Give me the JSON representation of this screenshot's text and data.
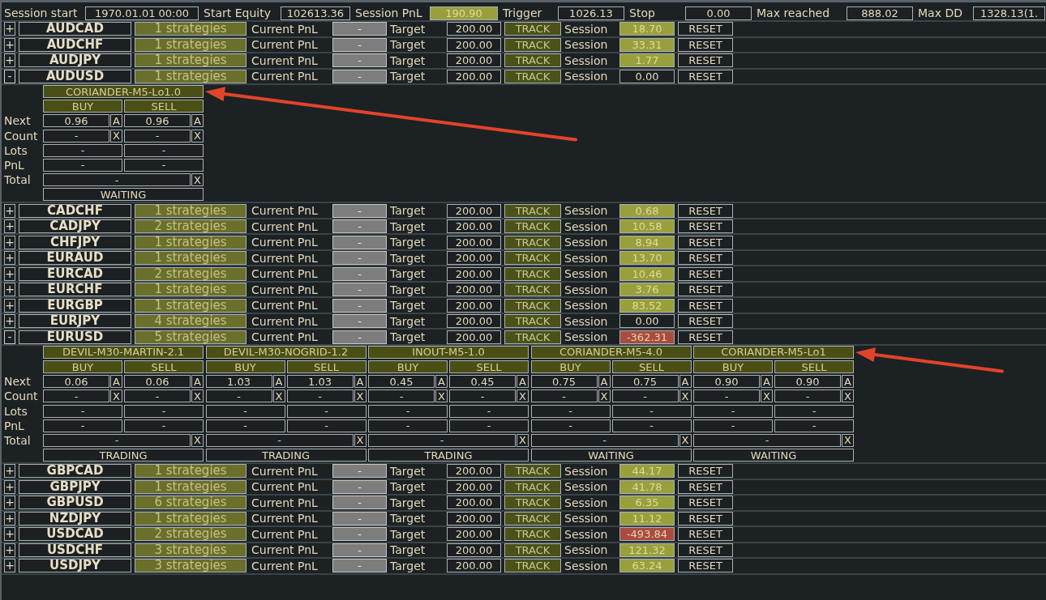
{
  "top_bar": {
    "fields": [
      {
        "label": "Session start",
        "value": "1970.01.01 00:00",
        "color": "#1c2022"
      },
      {
        "label": "Start Equity",
        "value": "102613.36",
        "color": "#1c2022"
      },
      {
        "label": "Session PnL",
        "value": "190.90",
        "color": "#98a03c"
      },
      {
        "label": "Trigger",
        "value": "1026.13",
        "color": "#1c2022"
      },
      {
        "label": "Stop",
        "value": "0.00",
        "color": "#1c2022"
      },
      {
        "label": "Max reached",
        "value": "888.02",
        "color": "#1c2022"
      },
      {
        "label": "Max DD",
        "value": "1328.13(1.",
        "color": "#1c2022"
      }
    ]
  },
  "rows": [
    {
      "toggle": "+",
      "expanded": false,
      "symbol": "AUDCAD",
      "strategies": "1 strategies",
      "pnl_label": "Current PnL",
      "current_pnl": "-",
      "target_label": "Target",
      "target": "200.00",
      "track": "TRACK",
      "session_label": "Session",
      "session": {
        "value": "18.70",
        "color": "#98a03c"
      },
      "reset": "RESET"
    },
    {
      "toggle": "+",
      "expanded": false,
      "symbol": "AUDCHF",
      "strategies": "1 strategies",
      "pnl_label": "Current PnL",
      "current_pnl": "-",
      "target_label": "Target",
      "target": "200.00",
      "track": "TRACK",
      "session_label": "Session",
      "session": {
        "value": "33.31",
        "color": "#98a03c"
      },
      "reset": "RESET"
    },
    {
      "toggle": "+",
      "expanded": false,
      "symbol": "AUDJPY",
      "strategies": "1 strategies",
      "pnl_label": "Current PnL",
      "current_pnl": "-",
      "target_label": "Target",
      "target": "200.00",
      "track": "TRACK",
      "session_label": "Session",
      "session": {
        "value": "1.77",
        "color": "#98a03c"
      },
      "reset": "RESET"
    },
    {
      "toggle": "-",
      "expanded": true,
      "symbol": "AUDUSD",
      "strategies": "1 strategies",
      "pnl_label": "Current PnL",
      "current_pnl": "-",
      "target_label": "Target",
      "target": "200.00",
      "track": "TRACK",
      "session_label": "Session",
      "session": {
        "value": "0.00",
        "color": "#1c2022"
      },
      "reset": "RESET",
      "panel": {
        "row_labels": [
          "Next",
          "Count",
          "Lots",
          "PnL",
          "Total"
        ],
        "strategies": [
          {
            "name": "CORIANDER-M5-Lo1.0",
            "marked": true,
            "sides": [
              {
                "label": "BUY",
                "next": "0.96",
                "next_action": "A",
                "count": "-",
                "count_action": "X",
                "lots": "-",
                "pnl": "-"
              },
              {
                "label": "SELL",
                "next": "0.96",
                "next_action": "A",
                "count": "-",
                "count_action": "X",
                "lots": "-",
                "pnl": "-"
              }
            ],
            "total": "-",
            "total_action": "X",
            "status": "WAITING"
          }
        ]
      }
    },
    {
      "toggle": "+",
      "expanded": false,
      "symbol": "CADCHF",
      "strategies": "1 strategies",
      "pnl_label": "Current PnL",
      "current_pnl": "-",
      "target_label": "Target",
      "target": "200.00",
      "track": "TRACK",
      "session_label": "Session",
      "session": {
        "value": "0.68",
        "color": "#98a03c"
      },
      "reset": "RESET"
    },
    {
      "toggle": "+",
      "expanded": false,
      "symbol": "CADJPY",
      "strategies": "2 strategies",
      "pnl_label": "Current PnL",
      "current_pnl": "-",
      "target_label": "Target",
      "target": "200.00",
      "track": "TRACK",
      "session_label": "Session",
      "session": {
        "value": "10.58",
        "color": "#98a03c"
      },
      "reset": "RESET"
    },
    {
      "toggle": "+",
      "expanded": false,
      "symbol": "CHFJPY",
      "strategies": "1 strategies",
      "pnl_label": "Current PnL",
      "current_pnl": "-",
      "target_label": "Target",
      "target": "200.00",
      "track": "TRACK",
      "session_label": "Session",
      "session": {
        "value": "8.94",
        "color": "#98a03c"
      },
      "reset": "RESET"
    },
    {
      "toggle": "+",
      "expanded": false,
      "symbol": "EURAUD",
      "strategies": "1 strategies",
      "pnl_label": "Current PnL",
      "current_pnl": "-",
      "target_label": "Target",
      "target": "200.00",
      "track": "TRACK",
      "session_label": "Session",
      "session": {
        "value": "13.70",
        "color": "#98a03c"
      },
      "reset": "RESET"
    },
    {
      "toggle": "+",
      "expanded": false,
      "symbol": "EURCAD",
      "strategies": "2 strategies",
      "pnl_label": "Current PnL",
      "current_pnl": "-",
      "target_label": "Target",
      "target": "200.00",
      "track": "TRACK",
      "session_label": "Session",
      "session": {
        "value": "10.46",
        "color": "#98a03c"
      },
      "reset": "RESET"
    },
    {
      "toggle": "+",
      "expanded": false,
      "symbol": "EURCHF",
      "strategies": "1 strategies",
      "pnl_label": "Current PnL",
      "current_pnl": "-",
      "target_label": "Target",
      "target": "200.00",
      "track": "TRACK",
      "session_label": "Session",
      "session": {
        "value": "3.76",
        "color": "#98a03c"
      },
      "reset": "RESET"
    },
    {
      "toggle": "+",
      "expanded": false,
      "symbol": "EURGBP",
      "strategies": "1 strategies",
      "pnl_label": "Current PnL",
      "current_pnl": "-",
      "target_label": "Target",
      "target": "200.00",
      "track": "TRACK",
      "session_label": "Session",
      "session": {
        "value": "83.52",
        "color": "#98a03c"
      },
      "reset": "RESET"
    },
    {
      "toggle": "+",
      "expanded": false,
      "symbol": "EURJPY",
      "strategies": "4 strategies",
      "pnl_label": "Current PnL",
      "current_pnl": "-",
      "target_label": "Target",
      "target": "200.00",
      "track": "TRACK",
      "session_label": "Session",
      "session": {
        "value": "0.00",
        "color": "#1c2022"
      },
      "reset": "RESET"
    },
    {
      "toggle": "-",
      "expanded": true,
      "symbol": "EURUSD",
      "strategies": "5 strategies",
      "pnl_label": "Current PnL",
      "current_pnl": "-",
      "target_label": "Target",
      "target": "200.00",
      "track": "TRACK",
      "session_label": "Session",
      "session": {
        "value": "-362.31",
        "color": "#a84c42"
      },
      "reset": "RESET",
      "panel": {
        "row_labels": [
          "Next",
          "Count",
          "Lots",
          "PnL",
          "Total"
        ],
        "strategies": [
          {
            "name": "DEVIL-M30-MARTIN-2.1",
            "marked": false,
            "sides": [
              {
                "label": "BUY",
                "next": "0.06",
                "next_action": "A",
                "count": "-",
                "count_action": "X",
                "lots": "-",
                "pnl": "-"
              },
              {
                "label": "SELL",
                "next": "0.06",
                "next_action": "A",
                "count": "-",
                "count_action": "X",
                "lots": "-",
                "pnl": "-"
              }
            ],
            "total": "-",
            "total_action": "X",
            "status": "TRADING"
          },
          {
            "name": "DEVIL-M30-NOGRID-1.2",
            "marked": false,
            "sides": [
              {
                "label": "BUY",
                "next": "1.03",
                "next_action": "A",
                "count": "-",
                "count_action": "X",
                "lots": "-",
                "pnl": "-"
              },
              {
                "label": "SELL",
                "next": "1.03",
                "next_action": "A",
                "count": "-",
                "count_action": "X",
                "lots": "-",
                "pnl": "-"
              }
            ],
            "total": "-",
            "total_action": "X",
            "status": "TRADING"
          },
          {
            "name": "INOUT-M5-1.0",
            "marked": false,
            "sides": [
              {
                "label": "BUY",
                "next": "0.45",
                "next_action": "A",
                "count": "-",
                "count_action": "X",
                "lots": "-",
                "pnl": "-"
              },
              {
                "label": "SELL",
                "next": "0.45",
                "next_action": "A",
                "count": "-",
                "count_action": "X",
                "lots": "-",
                "pnl": "-"
              }
            ],
            "total": "-",
            "total_action": "X",
            "status": "TRADING"
          },
          {
            "name": "CORIANDER-M5-4.0",
            "marked": false,
            "sides": [
              {
                "label": "BUY",
                "next": "0.75",
                "next_action": "A",
                "count": "-",
                "count_action": "X",
                "lots": "-",
                "pnl": "-"
              },
              {
                "label": "SELL",
                "next": "0.75",
                "next_action": "A",
                "count": "-",
                "count_action": "X",
                "lots": "-",
                "pnl": "-"
              }
            ],
            "total": "-",
            "total_action": "X",
            "status": "WAITING"
          },
          {
            "name": "CORIANDER-M5-Lo1",
            "marked": true,
            "sides": [
              {
                "label": "BUY",
                "next": "0.90",
                "next_action": "A",
                "count": "-",
                "count_action": "X",
                "lots": "-",
                "pnl": "-"
              },
              {
                "label": "SELL",
                "next": "0.90",
                "next_action": "A",
                "count": "-",
                "count_action": "X",
                "lots": "-",
                "pnl": "-"
              }
            ],
            "total": "-",
            "total_action": "X",
            "status": "WAITING"
          }
        ]
      }
    },
    {
      "toggle": "+",
      "expanded": false,
      "symbol": "GBPCAD",
      "strategies": "1 strategies",
      "pnl_label": "Current PnL",
      "current_pnl": "-",
      "target_label": "Target",
      "target": "200.00",
      "track": "TRACK",
      "session_label": "Session",
      "session": {
        "value": "44.17",
        "color": "#98a03c"
      },
      "reset": "RESET"
    },
    {
      "toggle": "+",
      "expanded": false,
      "symbol": "GBPJPY",
      "strategies": "1 strategies",
      "pnl_label": "Current PnL",
      "current_pnl": "-",
      "target_label": "Target",
      "target": "200.00",
      "track": "TRACK",
      "session_label": "Session",
      "session": {
        "value": "41.78",
        "color": "#98a03c"
      },
      "reset": "RESET"
    },
    {
      "toggle": "+",
      "expanded": false,
      "symbol": "GBPUSD",
      "strategies": "6 strategies",
      "pnl_label": "Current PnL",
      "current_pnl": "-",
      "target_label": "Target",
      "target": "200.00",
      "track": "TRACK",
      "session_label": "Session",
      "session": {
        "value": "6.35",
        "color": "#98a03c"
      },
      "reset": "RESET"
    },
    {
      "toggle": "+",
      "expanded": false,
      "symbol": "NZDJPY",
      "strategies": "1 strategies",
      "pnl_label": "Current PnL",
      "current_pnl": "-",
      "target_label": "Target",
      "target": "200.00",
      "track": "TRACK",
      "session_label": "Session",
      "session": {
        "value": "11.12",
        "color": "#98a03c"
      },
      "reset": "RESET"
    },
    {
      "toggle": "+",
      "expanded": false,
      "symbol": "USDCAD",
      "strategies": "2 strategies",
      "pnl_label": "Current PnL",
      "current_pnl": "-",
      "target_label": "Target",
      "target": "200.00",
      "track": "TRACK",
      "session_label": "Session",
      "session": {
        "value": "-493.84",
        "color": "#a84c42"
      },
      "reset": "RESET"
    },
    {
      "toggle": "+",
      "expanded": false,
      "symbol": "USDCHF",
      "strategies": "3 strategies",
      "pnl_label": "Current PnL",
      "current_pnl": "-",
      "target_label": "Target",
      "target": "200.00",
      "track": "TRACK",
      "session_label": "Session",
      "session": {
        "value": "121.32",
        "color": "#98a03c"
      },
      "reset": "RESET"
    },
    {
      "toggle": "+",
      "expanded": false,
      "symbol": "USDJPY",
      "strategies": "3 strategies",
      "pnl_label": "Current PnL",
      "current_pnl": "-",
      "target_label": "Target",
      "target": "200.00",
      "track": "TRACK",
      "session_label": "Session",
      "session": {
        "value": "63.24",
        "color": "#98a03c"
      },
      "reset": "RESET"
    }
  ]
}
